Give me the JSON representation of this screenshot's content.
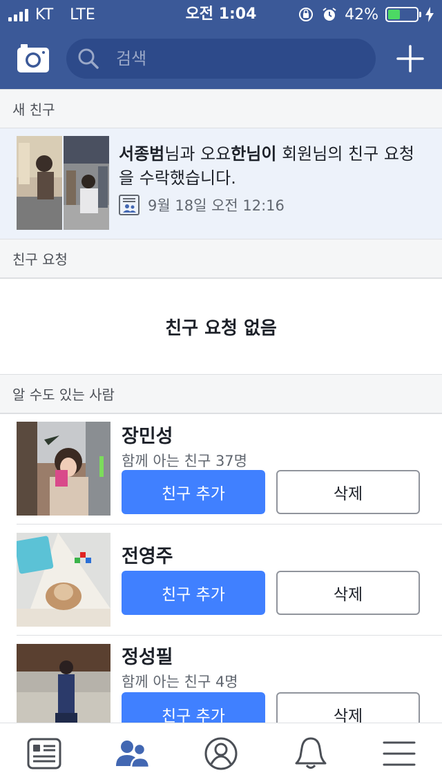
{
  "status_bar": {
    "carrier": "KT",
    "network": "LTE",
    "time": "오전 1:04",
    "battery_percent": "42%",
    "battery_level": 0.42,
    "battery_color": "#4cd964"
  },
  "nav": {
    "search_placeholder": "검색",
    "camera_icon": "camera-icon",
    "plus_icon": "plus-icon",
    "bar_color": "#3b5998"
  },
  "new_friends": {
    "header": "새 친구",
    "notification": {
      "user1": "서종범",
      "text1": "님과 오요",
      "user2": "한님이",
      "text2": " 회원님의 친구 요청을 수락했습니다.",
      "timestamp": "9월 18일 오전 12:16"
    }
  },
  "friend_requests": {
    "header": "친구 요청",
    "empty_text": "친구 요청 없음"
  },
  "pymk": {
    "header": "알 수도 있는 사람",
    "add_label": "친구 추가",
    "delete_label": "삭제",
    "people": [
      {
        "name": "장민성",
        "mutual": "함께 아는 친구 37명"
      },
      {
        "name": "전영주",
        "mutual": ""
      },
      {
        "name": "정성필",
        "mutual": "함께 아는 친구 4명"
      }
    ]
  },
  "tabs": [
    {
      "icon": "news-feed-icon"
    },
    {
      "icon": "friends-icon",
      "active": true
    },
    {
      "icon": "profile-icon"
    },
    {
      "icon": "notifications-icon"
    },
    {
      "icon": "menu-icon"
    }
  ],
  "colors": {
    "accent": "#4080ff",
    "active_tab": "#4267b2",
    "inactive_tab": "#4b4f56"
  }
}
